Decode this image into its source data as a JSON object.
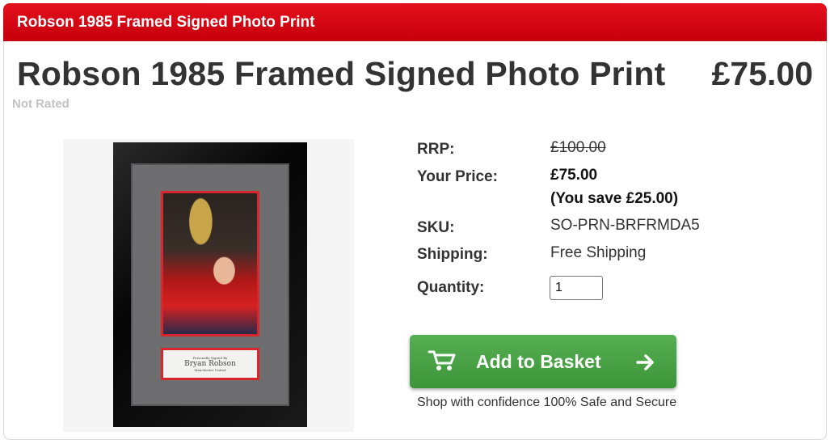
{
  "banner": {
    "title": "Robson 1985 Framed Signed Photo Print"
  },
  "product": {
    "title": "Robson 1985 Framed Signed Photo Print",
    "price": "£75.00",
    "rating": "Not Rated",
    "image": {
      "plaque_name": "Bryan Robson",
      "plaque_line_top": "Personally Signed By",
      "plaque_line_bottom": "Manchester United"
    }
  },
  "details": {
    "rrp_label": "RRP:",
    "rrp_value": "£100.00",
    "your_price_label": "Your Price:",
    "your_price_value": "£75.00",
    "you_save": "(You save £25.00)",
    "sku_label": "SKU:",
    "sku_value": "SO-PRN-BRFRMDA5",
    "shipping_label": "Shipping:",
    "shipping_value": "Free Shipping",
    "quantity_label": "Quantity:",
    "quantity_value": "1"
  },
  "actions": {
    "add_to_basket": "Add to Basket",
    "confidence_text": "Shop with confidence 100% Safe and Secure"
  },
  "colors": {
    "banner": "#d4000f",
    "button": "#4aa247",
    "text": "#333333",
    "rating": "#c2c2c2"
  },
  "icons": [
    "cart-icon",
    "arrow-right-icon"
  ]
}
